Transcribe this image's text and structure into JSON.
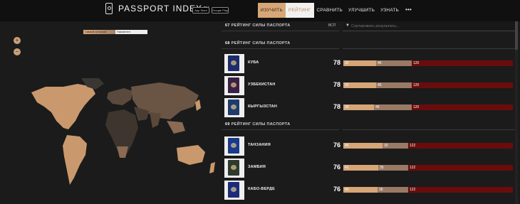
{
  "header": {
    "logo": "PASSPORT INDEX",
    "tm": "TM",
    "app_store": "App Store",
    "google_play": "Google Play",
    "nav": [
      "ИЗУЧИТЬ",
      "РЕЙТИНГ",
      "СРАВНИТЬ",
      "УЛУЧШИТЬ",
      "УЗНАТЬ"
    ],
    "more": "•••"
  },
  "map": {
    "zoom_in": "+",
    "zoom_out": "−",
    "legend_strong": "Самый сильный",
    "legend_weak": "Наименее"
  },
  "list": {
    "vsp": "ВСП",
    "search_placeholder": "Сортировать результаты...",
    "search_icon": "filter-icon",
    "groups": [
      {
        "rank": "67",
        "title": "РЕЙТИНГ СИЛЫ ПАСПОРТА"
      },
      {
        "rank": "68",
        "title": "РЕЙТИНГ СИЛЫ ПАСПОРТА"
      },
      {
        "rank": "69",
        "title": "РЕЙТИНГ СИЛЫ ПАСПОРТА"
      }
    ],
    "rows": [
      {
        "country": "КУБА",
        "score": "78",
        "v1": "32",
        "v2": "46",
        "v3": "120",
        "color": "#1d2a6b"
      },
      {
        "country": "УЗБЕКИСТАН",
        "score": "78",
        "v1": "32",
        "v2": "46",
        "v3": "120",
        "color": "#3c2044"
      },
      {
        "country": "КЫРГЫЗСТАН",
        "score": "78",
        "v1": "30",
        "v2": "48",
        "v3": "120",
        "color": "#1f3b6e"
      },
      {
        "country": "ТАНЗАНИЯ",
        "score": "76",
        "v1": "46",
        "v2": "30",
        "v3": "122",
        "color": "#1a3a8a"
      },
      {
        "country": "ЗАМБИЯ",
        "score": "76",
        "v1": "41",
        "v2": "35",
        "v3": "122",
        "color": "#2f3a2e"
      },
      {
        "country": "КАБО-ВЕРДЕ",
        "score": "76",
        "v1": "40",
        "v2": "36",
        "v3": "122",
        "color": "#1c2a78"
      }
    ]
  }
}
